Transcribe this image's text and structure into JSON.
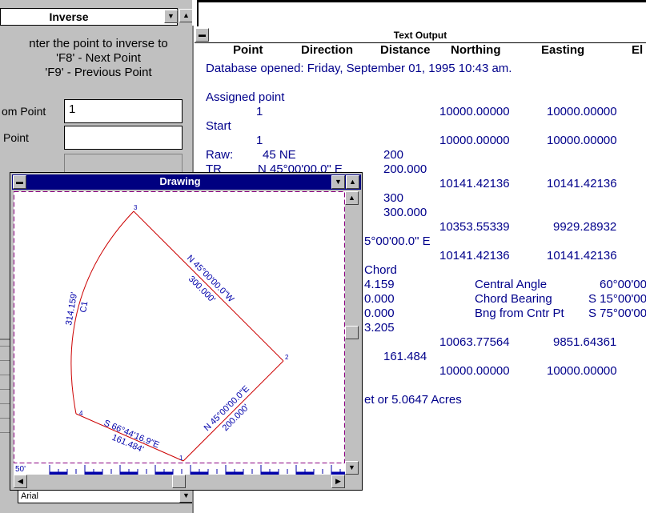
{
  "inverse": {
    "title": "Inverse",
    "help_lines": [
      "nter the point to inverse to",
      "'F8' - Next Point",
      "'F9' - Previous Point"
    ],
    "from_point_label": "om Point",
    "from_point_value": "1",
    "to_point_label": "Point",
    "to_point_value": "",
    "font_select": "Arial"
  },
  "output": {
    "title": "Text Output",
    "columns": [
      "Point",
      "Direction",
      "Distance",
      "Northing",
      "Easting",
      "El"
    ],
    "lines": [
      {
        "text": "Database opened: Friday, September 01, 1995  10:43 am."
      },
      {
        "text": "Assigned point"
      },
      {
        "point": "1",
        "northing": "10000.00000",
        "easting": "10000.00000"
      },
      {
        "text": "Start"
      },
      {
        "point": "1",
        "northing": "10000.00000",
        "easting": "10000.00000"
      },
      {
        "raw_label": "Raw:",
        "raw_dir": "45 NE",
        "raw_dist": "200"
      },
      {
        "tr_label": "TR",
        "tr_dir": "N 45°00'00.0\" E",
        "tr_dist": "200.000"
      },
      {
        "northing": "10141.42136",
        "easting": "10141.42136"
      },
      {
        "dist": "300"
      },
      {
        "dist": "300.000"
      },
      {
        "northing": "10353.55339",
        "easting": "9929.28932"
      },
      {
        "dir": "5°00'00.0\" E"
      },
      {
        "northing": "10141.42136",
        "easting": "10141.42136"
      },
      {
        "chord": "Chord"
      },
      {
        "v1": "4.159",
        "label": "Central Angle",
        "v2": "60°00'00"
      },
      {
        "v1": "0.000",
        "label": "Chord Bearing",
        "v2": "S 15°00'00"
      },
      {
        "v1": "0.000",
        "label": "Bng from Cntr Pt",
        "v2": "S 75°00'00"
      },
      {
        "v1": "3.205"
      },
      {
        "northing": "10063.77564",
        "easting": "9851.64361"
      },
      {
        "dist": "161.484"
      },
      {
        "northing": "10000.00000",
        "easting": "10000.00000"
      },
      {
        "text": "et or 5.0647 Acres"
      }
    ]
  },
  "drawing": {
    "title": "Drawing",
    "scale_label": "50'",
    "points": [
      {
        "id": "1",
        "label": "1"
      },
      {
        "id": "2",
        "label": "2"
      },
      {
        "id": "3",
        "label": "3"
      },
      {
        "id": "4",
        "label": "4"
      }
    ],
    "line_labels": {
      "l12_bearing": "N 45°00'00.0\"E",
      "l12_dist": "200.000'",
      "l23_bearing": "N 45°00'00.0\"W",
      "l23_dist": "300.000'",
      "curve_len": "314.159'",
      "curve_name": "C1",
      "l41_bearing": "S 66°44'16.9\"E",
      "l41_dist": "161.484'"
    },
    "line_color": "#cc0000",
    "label_color": "#0000aa"
  },
  "colors": {
    "title_active": "#000080",
    "output_text": "#00008b",
    "window_gray": "#c0c0c0"
  }
}
